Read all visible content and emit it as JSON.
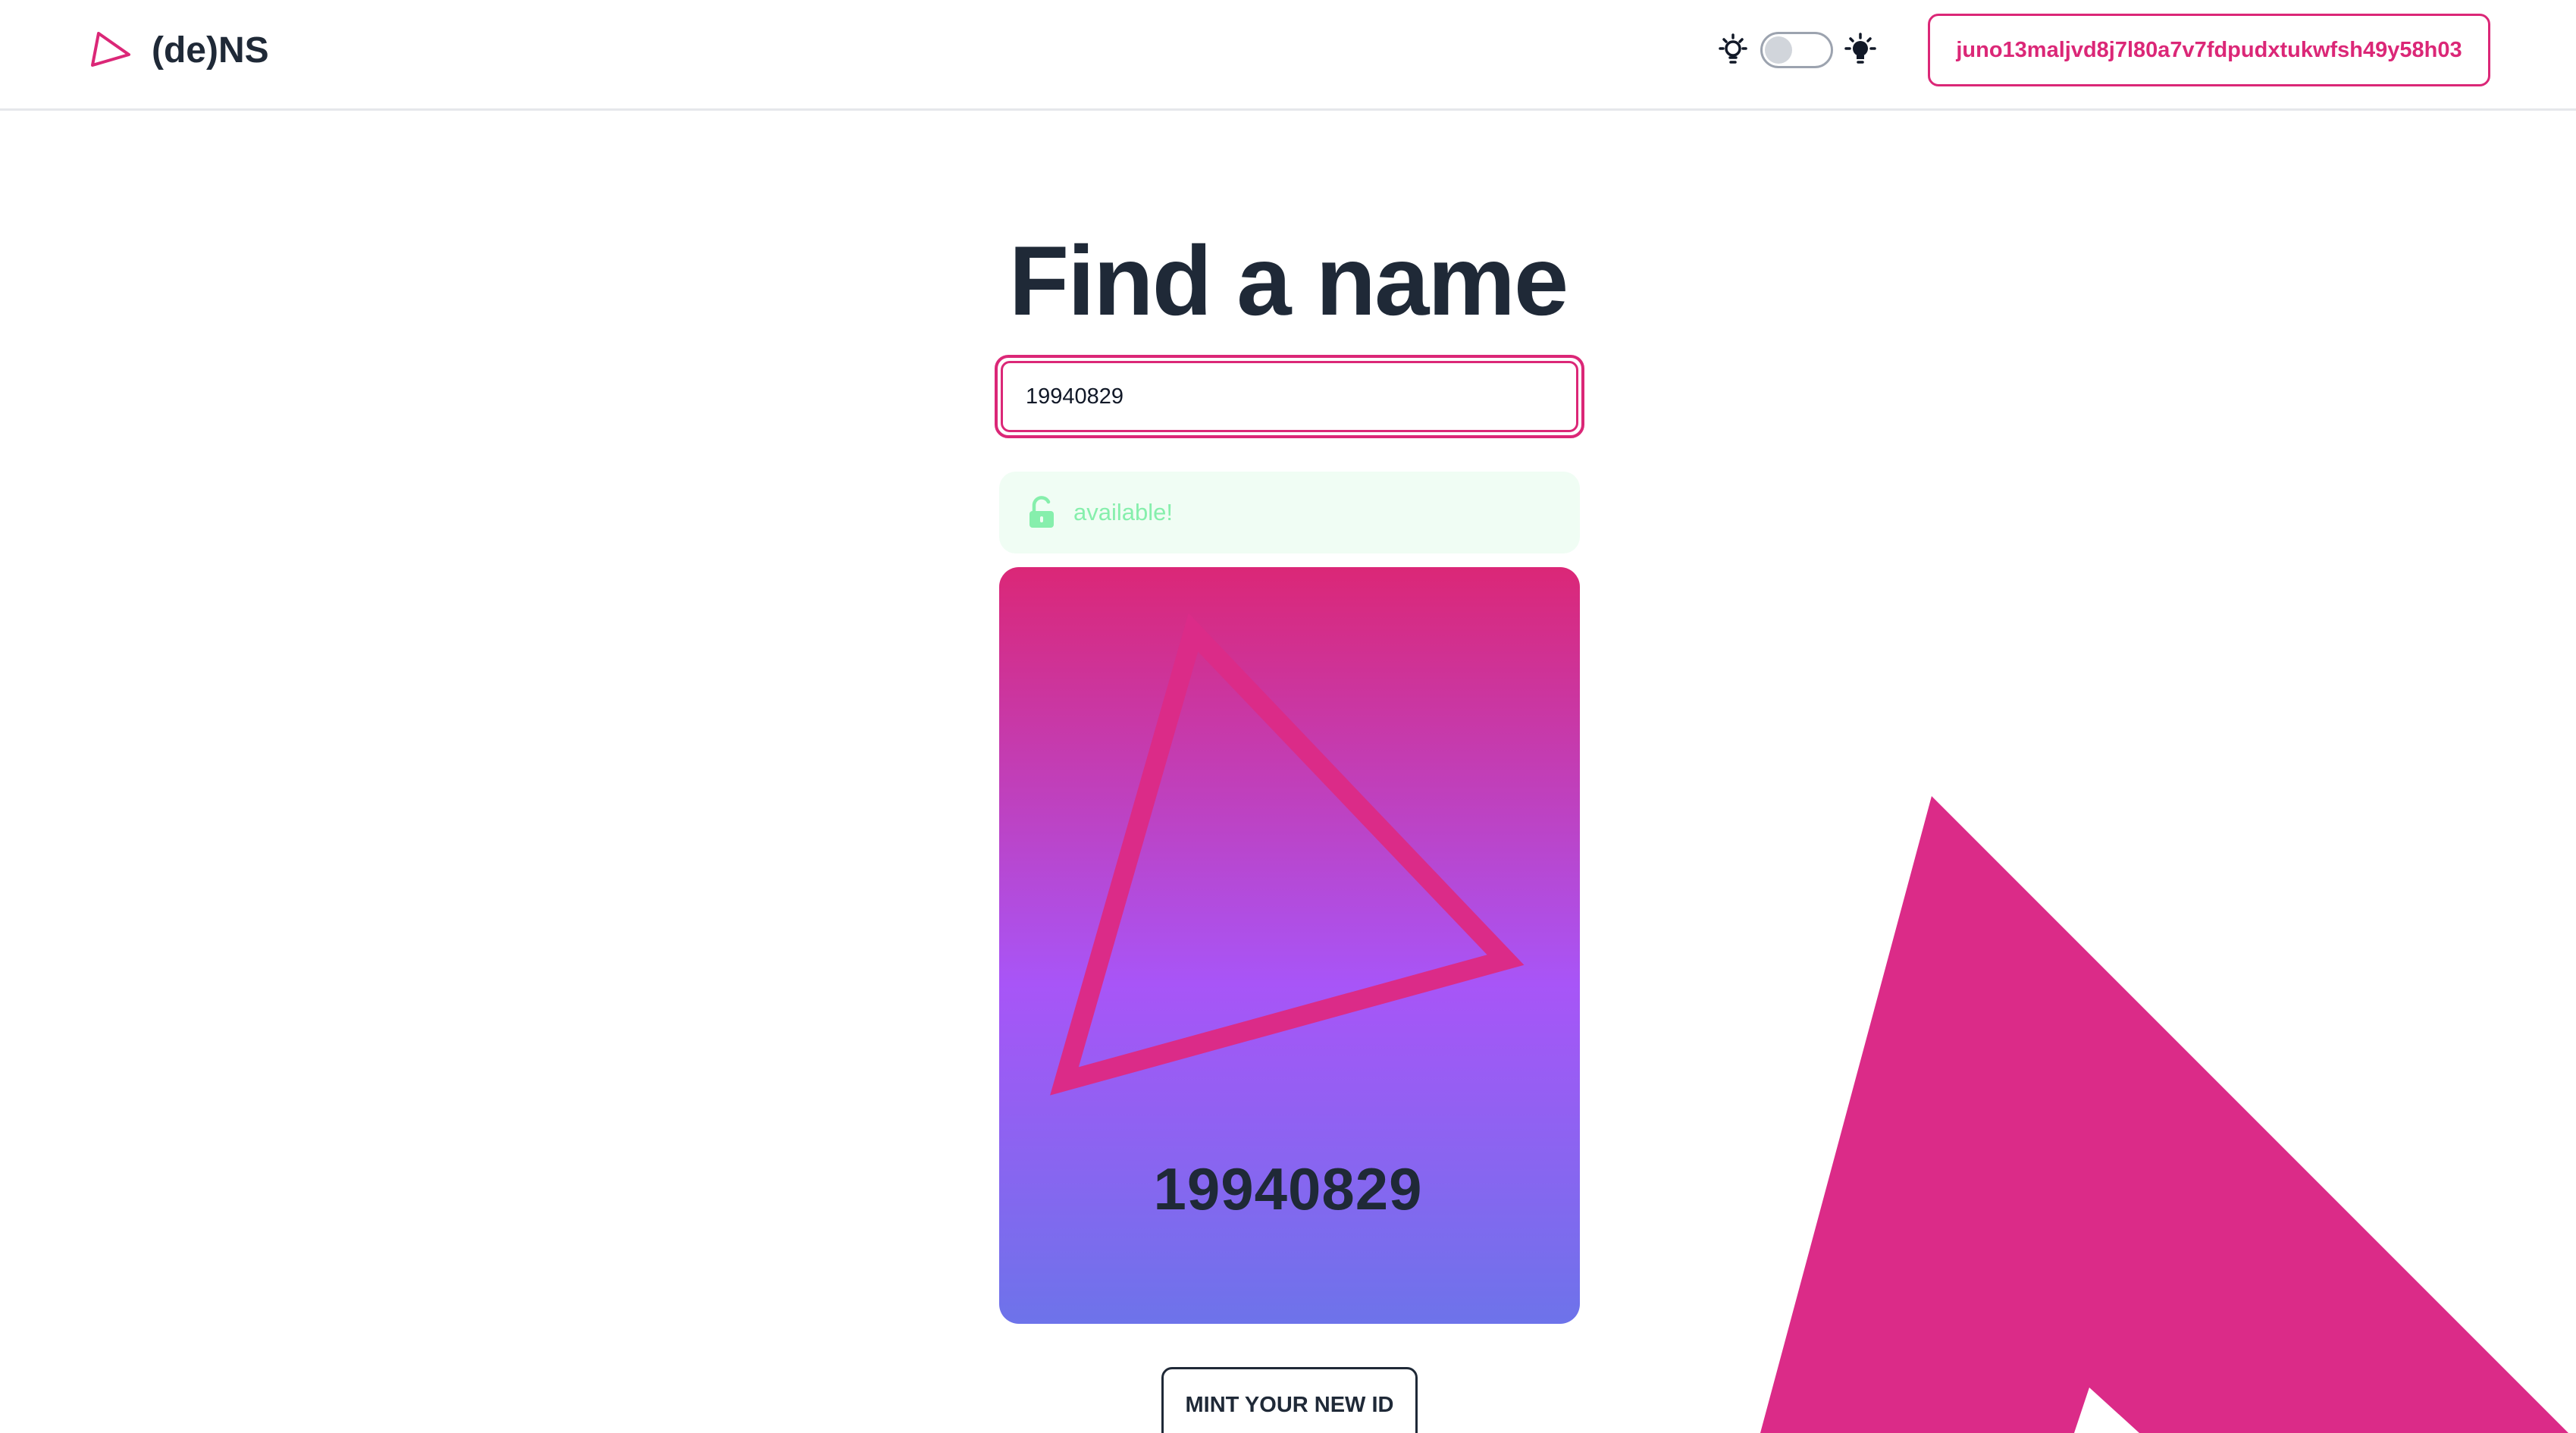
{
  "header": {
    "brand": "(de)NS",
    "wallet_address": "juno13maljvd8j7l80a7v7fdpudxtukwfsh49y58h03",
    "theme_toggle": {
      "dark_mode": false
    }
  },
  "main": {
    "title": "Find a name",
    "search": {
      "value": "19940829"
    },
    "status": {
      "text": "available!",
      "color": "#86efac",
      "icon": "unlock-icon"
    },
    "card": {
      "name": "19940829",
      "gradient": [
        "#db2777",
        "#a855f7",
        "#6d73ea"
      ]
    },
    "mint_label": "MINT YOUR NEW ID"
  },
  "colors": {
    "accent": "#db2777",
    "text": "#1f2937",
    "success": "#86efac"
  }
}
